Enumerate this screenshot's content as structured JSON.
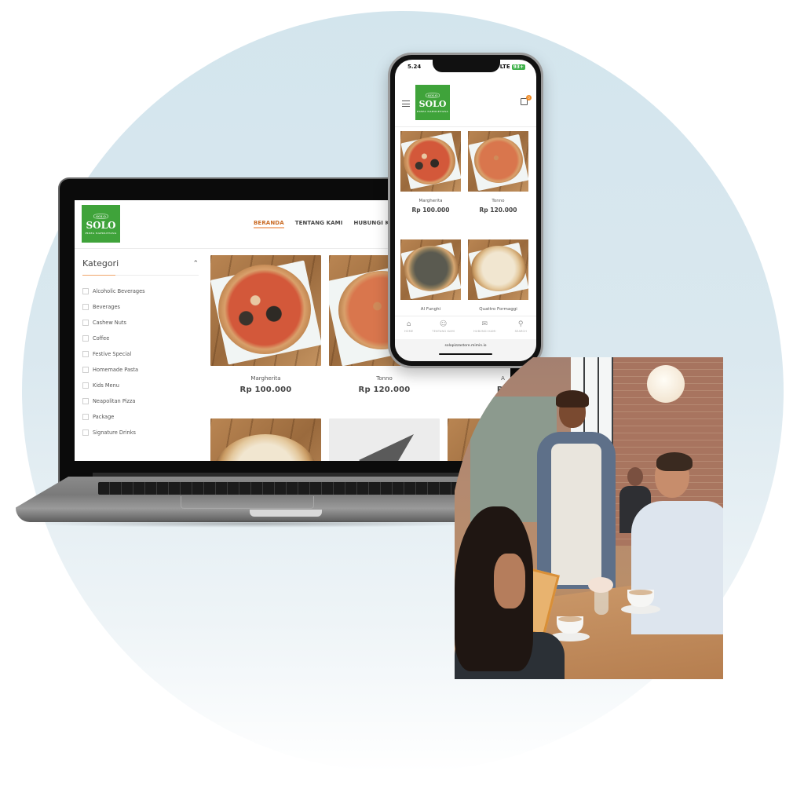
{
  "brand": {
    "logo_text": "SOLO",
    "logo_crown": "SOLO",
    "logo_sub": "PIZZA NAPOLETANA",
    "brand_color": "#3fa33a",
    "accent_color": "#f0a66b"
  },
  "laptop": {
    "nav": [
      {
        "label": "BERANDA",
        "active": true
      },
      {
        "label": "TENTANG KAMI",
        "active": false
      },
      {
        "label": "HUBUNGI KAMI",
        "active": false
      }
    ],
    "sidebar": {
      "title": "Kategori",
      "collapse_icon": "chevron-up-icon",
      "categories": [
        {
          "label": "Alcoholic Beverages",
          "checked": false
        },
        {
          "label": "Beverages",
          "checked": false
        },
        {
          "label": "Cashew Nuts",
          "checked": false
        },
        {
          "label": "Coffee",
          "checked": false
        },
        {
          "label": "Festive Special",
          "checked": false
        },
        {
          "label": "Homemade Pasta",
          "checked": false
        },
        {
          "label": "Kids Menu",
          "checked": false
        },
        {
          "label": "Neapolitan Pizza",
          "checked": false
        },
        {
          "label": "Package",
          "checked": false
        },
        {
          "label": "Signature Drinks",
          "checked": false
        }
      ]
    },
    "products": [
      {
        "name": "Margherita",
        "price": "Rp 100.000"
      },
      {
        "name": "Tonno",
        "price": "Rp 120.000"
      },
      {
        "name": "A",
        "price": "Rp"
      }
    ]
  },
  "phone": {
    "status": {
      "time": "5.24",
      "network": "LTE",
      "battery": "93+"
    },
    "cart_count": "0",
    "products": [
      {
        "name": "Margherita",
        "price": "Rp 100.000"
      },
      {
        "name": "Tonno",
        "price": "Rp 120.000"
      },
      {
        "name": "Al Funghi",
        "price": ""
      },
      {
        "name": "Quattro Formaggi",
        "price": ""
      }
    ],
    "tabbar": [
      {
        "label": "HOME",
        "icon": "home-icon"
      },
      {
        "label": "TENTANG KAMI",
        "icon": "user-icon"
      },
      {
        "label": "HUBUNGI KAMI",
        "icon": "mail-icon"
      },
      {
        "label": "SEARCH",
        "icon": "search-icon"
      }
    ],
    "url": "solopizzastore.mimin.io"
  }
}
